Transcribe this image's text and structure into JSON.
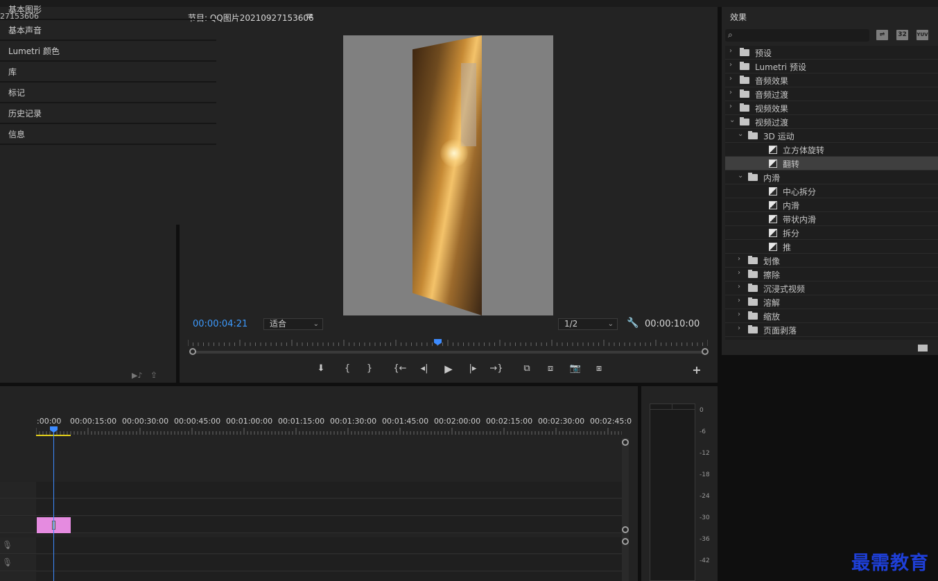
{
  "source": {
    "title_fragment": "27153606"
  },
  "program": {
    "title": "节目: QQ图片20210927153606",
    "menu_icon": "≡",
    "current_timecode": "00:00:04:21",
    "fit_label": "适合",
    "resolution_label": "1/2",
    "duration_timecode": "00:00:10:00",
    "playhead_fraction": 0.48
  },
  "effects": {
    "title": "效果",
    "search_placeholder": "",
    "btn_accel": "",
    "btn_32": "32",
    "btn_yuv": "YUV",
    "tree": [
      {
        "label": "预设",
        "indent": 0,
        "type": "folder",
        "arrow": "›"
      },
      {
        "label": "Lumetri 预设",
        "indent": 0,
        "type": "folder",
        "arrow": "›"
      },
      {
        "label": "音频效果",
        "indent": 0,
        "type": "folder",
        "arrow": "›"
      },
      {
        "label": "音频过渡",
        "indent": 0,
        "type": "folder",
        "arrow": "›"
      },
      {
        "label": "视频效果",
        "indent": 0,
        "type": "folder",
        "arrow": "›"
      },
      {
        "label": "视频过渡",
        "indent": 0,
        "type": "folder",
        "arrow": "⌄"
      },
      {
        "label": "3D 运动",
        "indent": 1,
        "type": "folder",
        "arrow": "⌄"
      },
      {
        "label": "立方体旋转",
        "indent": 2,
        "type": "item",
        "arrow": ""
      },
      {
        "label": "翻转",
        "indent": 2,
        "type": "item",
        "arrow": "",
        "selected": true
      },
      {
        "label": "内滑",
        "indent": 1,
        "type": "folder",
        "arrow": "⌄"
      },
      {
        "label": "中心拆分",
        "indent": 2,
        "type": "item",
        "arrow": ""
      },
      {
        "label": "内滑",
        "indent": 2,
        "type": "item",
        "arrow": ""
      },
      {
        "label": "带状内滑",
        "indent": 2,
        "type": "item",
        "arrow": ""
      },
      {
        "label": "拆分",
        "indent": 2,
        "type": "item",
        "arrow": ""
      },
      {
        "label": "推",
        "indent": 2,
        "type": "item",
        "arrow": ""
      },
      {
        "label": "划像",
        "indent": 1,
        "type": "folder",
        "arrow": "›"
      },
      {
        "label": "擦除",
        "indent": 1,
        "type": "folder",
        "arrow": "›"
      },
      {
        "label": "沉浸式视频",
        "indent": 1,
        "type": "folder",
        "arrow": "›"
      },
      {
        "label": "溶解",
        "indent": 1,
        "type": "folder",
        "arrow": "›"
      },
      {
        "label": "缩放",
        "indent": 1,
        "type": "folder",
        "arrow": "›"
      },
      {
        "label": "页面剥落",
        "indent": 1,
        "type": "folder",
        "arrow": "›"
      }
    ]
  },
  "stack_panels": [
    "基本图形",
    "基本声音",
    "Lumetri 颜色",
    "库",
    "标记",
    "历史记录",
    "信息"
  ],
  "timeline": {
    "ruler_labels": [
      ":00:00",
      "00:00:15:00",
      "00:00:30:00",
      "00:00:45:00",
      "00:01:00:00",
      "00:01:15:00",
      "00:01:30:00",
      "00:01:45:00",
      "00:02:00:00",
      "00:02:15:00",
      "00:02:30:00",
      "00:02:45:0"
    ],
    "clip_color": "#e58be0"
  },
  "meter": {
    "db_labels": [
      "0",
      "-6",
      "-12",
      "-18",
      "-24",
      "-30",
      "-36",
      "-42"
    ]
  },
  "watermark": "最需教育",
  "colors": {
    "accent_blue": "#3d9bff"
  }
}
